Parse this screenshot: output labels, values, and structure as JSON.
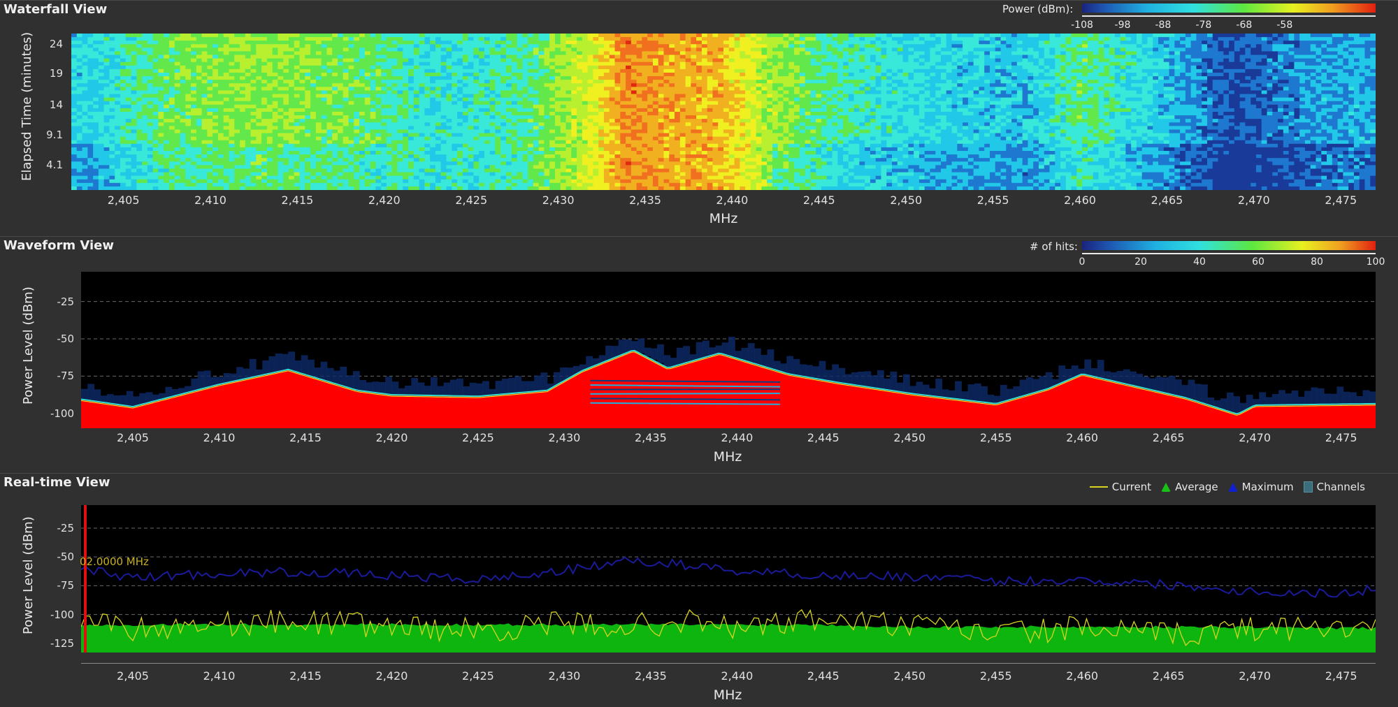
{
  "waterfall": {
    "title": "Waterfall View",
    "legend_label": "Power (dBm):",
    "legend_ticks": [
      "-108",
      "-98",
      "-88",
      "-78",
      "-68",
      "-58"
    ],
    "ylabel": "Elapsed Time (minutes)",
    "yticks": [
      "24",
      "19",
      "14",
      "9.1",
      "4.1"
    ],
    "xlabel": "MHz",
    "colors": [
      "#1e3a8c",
      "#1fb0e0",
      "#30e8e0",
      "#60e840",
      "#f0f020",
      "#f08020",
      "#e02010"
    ]
  },
  "waveform": {
    "title": "Waveform View",
    "legend_label": "# of hits:",
    "legend_ticks": [
      "0",
      "20",
      "40",
      "60",
      "80",
      "100"
    ],
    "ylabel": "Power Level (dBm)",
    "yticks": [
      "-25",
      "-50",
      "-75",
      "-100"
    ],
    "xlabel": "MHz"
  },
  "realtime": {
    "title": "Real-time View",
    "legend": {
      "current": "Current",
      "average": "Average",
      "maximum": "Maximum",
      "channels": "Channels"
    },
    "marker_label": "02.0000 MHz",
    "ylabel": "Power Level (dBm)",
    "yticks": [
      "-25",
      "-50",
      "-75",
      "-100",
      "-125"
    ],
    "xlabel": "MHz",
    "colors": {
      "current": "#d8d420",
      "average": "#0fb50f",
      "maximum": "#1a1a9a",
      "marker": "#e01010"
    }
  },
  "x_axis_ticks": [
    "2,405",
    "2,410",
    "2,415",
    "2,420",
    "2,425",
    "2,430",
    "2,435",
    "2,440",
    "2,445",
    "2,450",
    "2,455",
    "2,460",
    "2,465",
    "2,470",
    "2,475"
  ],
  "chart_data": [
    {
      "type": "heatmap",
      "title": "Waterfall View",
      "xlabel": "MHz",
      "ylabel": "Elapsed Time (minutes)",
      "xlim": [
        2402,
        2477
      ],
      "colorbar": {
        "label": "Power (dBm):",
        "range": [
          -108,
          -52
        ]
      },
      "x": [
        2403,
        2408,
        2413,
        2418,
        2423,
        2428,
        2432,
        2434,
        2437,
        2439,
        2442,
        2447,
        2452,
        2457,
        2460,
        2465,
        2469,
        2474
      ],
      "power_dBm": [
        -92,
        -82,
        -80,
        -82,
        -90,
        -86,
        -74,
        -62,
        -66,
        -66,
        -78,
        -88,
        -92,
        -94,
        -84,
        -94,
        -104,
        -96
      ]
    },
    {
      "type": "area",
      "title": "Waveform View",
      "xlabel": "MHz",
      "ylabel": "Power Level (dBm)",
      "xlim": [
        2402,
        2477
      ],
      "ylim": [
        -110,
        -5
      ],
      "colorbar": {
        "label": "# of hits:",
        "range": [
          0,
          100
        ]
      },
      "x": [
        2402,
        2405,
        2410,
        2414,
        2418,
        2420,
        2425,
        2429,
        2431,
        2434,
        2436,
        2439,
        2443,
        2446,
        2450,
        2455,
        2458,
        2460,
        2463,
        2466,
        2469,
        2470,
        2477
      ],
      "y": [
        -91,
        -96,
        -81,
        -71,
        -85,
        -88,
        -89,
        -85,
        -72,
        -58,
        -70,
        -60,
        -74,
        -80,
        -87,
        -94,
        -84,
        -74,
        -82,
        -90,
        -101,
        -95,
        -94
      ]
    },
    {
      "type": "line",
      "title": "Real-time View",
      "xlabel": "MHz",
      "ylabel": "Power Level (dBm)",
      "xlim": [
        2402,
        2477
      ],
      "ylim": [
        -133,
        -5
      ],
      "x": [
        2402,
        2405,
        2410,
        2415,
        2420,
        2425,
        2430,
        2434,
        2437,
        2440,
        2445,
        2450,
        2455,
        2460,
        2465,
        2470,
        2475,
        2477
      ],
      "series": [
        {
          "name": "Maximum",
          "values": [
            -60,
            -68,
            -64,
            -63,
            -66,
            -70,
            -62,
            -53,
            -57,
            -62,
            -66,
            -67,
            -71,
            -70,
            -74,
            -80,
            -82,
            -78
          ]
        },
        {
          "name": "Average",
          "values": [
            -110,
            -110,
            -110,
            -110,
            -110,
            -110,
            -110,
            -110,
            -110,
            -110,
            -110,
            -112,
            -112,
            -112,
            -112,
            -112,
            -113,
            -113
          ]
        },
        {
          "name": "Current",
          "values": [
            -100,
            -112,
            -108,
            -106,
            -110,
            -114,
            -108,
            -110,
            -106,
            -112,
            -104,
            -110,
            -116,
            -112,
            -118,
            -112,
            -110,
            -114
          ]
        }
      ],
      "marker_mhz": 2402.0
    }
  ]
}
